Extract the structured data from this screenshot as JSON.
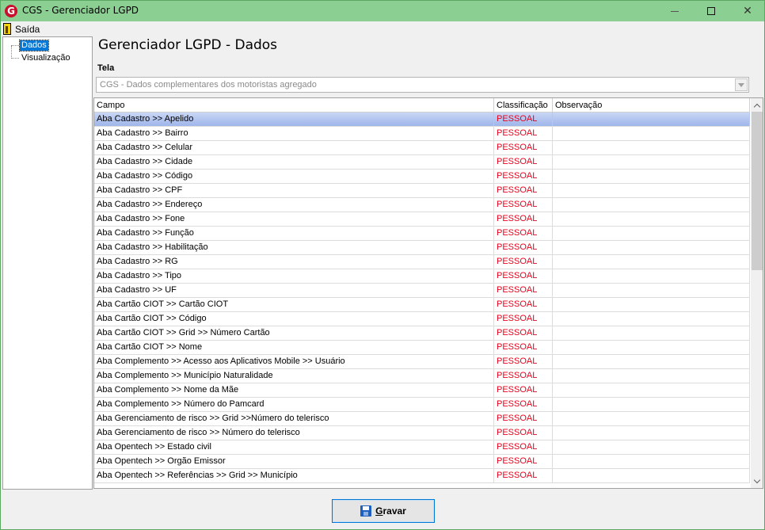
{
  "window": {
    "title": "CGS - Gerenciador LGPD",
    "app_icon_letter": "G",
    "minimize_glyph": "",
    "close_glyph": "✕"
  },
  "menu": {
    "exit_label": "Saída"
  },
  "tree": {
    "items": [
      {
        "label": "Dados",
        "selected": true
      },
      {
        "label": "Visualização",
        "selected": false
      }
    ]
  },
  "main": {
    "heading": "Gerenciador LGPD - Dados",
    "tela_label": "Tela",
    "tela_value": "CGS - Dados complementares dos motoristas agregado"
  },
  "grid": {
    "columns": [
      "Campo",
      "Classificação",
      "Observação"
    ],
    "rows": [
      {
        "campo": "Aba Cadastro >> Apelido",
        "classificacao": "PESSOAL",
        "observacao": ""
      },
      {
        "campo": "Aba Cadastro >> Bairro",
        "classificacao": "PESSOAL",
        "observacao": ""
      },
      {
        "campo": "Aba Cadastro >> Celular",
        "classificacao": "PESSOAL",
        "observacao": ""
      },
      {
        "campo": "Aba Cadastro >> Cidade",
        "classificacao": "PESSOAL",
        "observacao": ""
      },
      {
        "campo": "Aba Cadastro >> Código",
        "classificacao": "PESSOAL",
        "observacao": ""
      },
      {
        "campo": "Aba Cadastro >> CPF",
        "classificacao": "PESSOAL",
        "observacao": ""
      },
      {
        "campo": "Aba Cadastro >> Endereço",
        "classificacao": "PESSOAL",
        "observacao": ""
      },
      {
        "campo": "Aba Cadastro >> Fone",
        "classificacao": "PESSOAL",
        "observacao": ""
      },
      {
        "campo": "Aba Cadastro >> Função",
        "classificacao": "PESSOAL",
        "observacao": ""
      },
      {
        "campo": "Aba Cadastro >> Habilitação",
        "classificacao": "PESSOAL",
        "observacao": ""
      },
      {
        "campo": "Aba Cadastro >> RG",
        "classificacao": "PESSOAL",
        "observacao": ""
      },
      {
        "campo": "Aba Cadastro >> Tipo",
        "classificacao": "PESSOAL",
        "observacao": ""
      },
      {
        "campo": "Aba Cadastro >> UF",
        "classificacao": "PESSOAL",
        "observacao": ""
      },
      {
        "campo": "Aba Cartão CIOT >> Cartão CIOT",
        "classificacao": "PESSOAL",
        "observacao": ""
      },
      {
        "campo": "Aba Cartão CIOT >> Código",
        "classificacao": "PESSOAL",
        "observacao": ""
      },
      {
        "campo": "Aba Cartão CIOT >> Grid >> Número Cartão",
        "classificacao": "PESSOAL",
        "observacao": ""
      },
      {
        "campo": "Aba Cartão CIOT >> Nome",
        "classificacao": "PESSOAL",
        "observacao": ""
      },
      {
        "campo": "Aba Complemento >> Acesso aos Aplicativos Mobile >> Usuário",
        "classificacao": "PESSOAL",
        "observacao": ""
      },
      {
        "campo": "Aba Complemento >> Município Naturalidade",
        "classificacao": "PESSOAL",
        "observacao": ""
      },
      {
        "campo": "Aba Complemento >> Nome da Mãe",
        "classificacao": "PESSOAL",
        "observacao": ""
      },
      {
        "campo": "Aba Complemento >> Número do Pamcard",
        "classificacao": "PESSOAL",
        "observacao": ""
      },
      {
        "campo": "Aba Gerenciamento de risco >> Grid >>Número do telerisco",
        "classificacao": "PESSOAL",
        "observacao": ""
      },
      {
        "campo": "Aba Gerenciamento de risco >> Número do telerisco",
        "classificacao": "PESSOAL",
        "observacao": ""
      },
      {
        "campo": "Aba Opentech >> Estado civil",
        "classificacao": "PESSOAL",
        "observacao": ""
      },
      {
        "campo": "Aba Opentech >> Orgão Emissor",
        "classificacao": "PESSOAL",
        "observacao": ""
      },
      {
        "campo": "Aba Opentech >> Referências >> Grid >> Município",
        "classificacao": "PESSOAL",
        "observacao": ""
      }
    ]
  },
  "footer": {
    "save_accel": "G",
    "save_rest": "ravar"
  },
  "colors": {
    "titlebar": "#8ccf93",
    "classification_text": "#e8001c",
    "selection": "#0078d7"
  }
}
